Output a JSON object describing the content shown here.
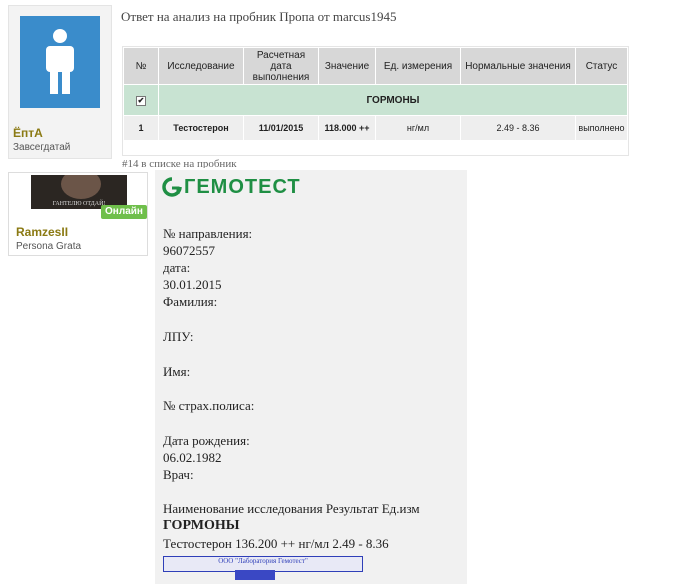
{
  "post1": {
    "user": {
      "name": "ЁптА",
      "title": "Завсегдатай"
    },
    "title": "Ответ на анализ на пробник Пропа от marcus1945",
    "table": {
      "headers": [
        "№",
        "Исследование",
        "Расчетная дата выполнения",
        "Значение",
        "Ед. измерения",
        "Нормальные значения",
        "Статус"
      ],
      "group": "ГОРМОНЫ",
      "rows": [
        {
          "num": "1",
          "test": "Тестостерон",
          "date": "11/01/2015",
          "value": "118.000 ++",
          "unit": "нг/мл",
          "norm": "2.49 - 8.36",
          "status": "выполнено"
        }
      ]
    },
    "cut_text": "#14 в списке на пробник"
  },
  "post2": {
    "user": {
      "name": "RamzesII",
      "title": "Persona Grata",
      "online": "Онлайн",
      "avatar_caption": "ГАНТЕЛЮ ОТДАЙ!"
    }
  },
  "document": {
    "logo": "ГЕМОТЕСТ",
    "lines": [
      "№ направления:",
      "96072557",
      "дата:",
      "30.01.2015",
      "Фамилия:",
      "ЛПУ:",
      "Имя:",
      "№ страх.полиса:",
      "Дата рождения:",
      "06.02.1982",
      "Врач:",
      "Наименование исследования Результат Ед.изм",
      "ГОРМОНЫ",
      "Тестостерон 136.200 ++ нг/мл 2.49 - 8.36"
    ],
    "stamp": "ООО \"Лаборатория Гемотест\"",
    "brand_color": "#1f8f44"
  }
}
